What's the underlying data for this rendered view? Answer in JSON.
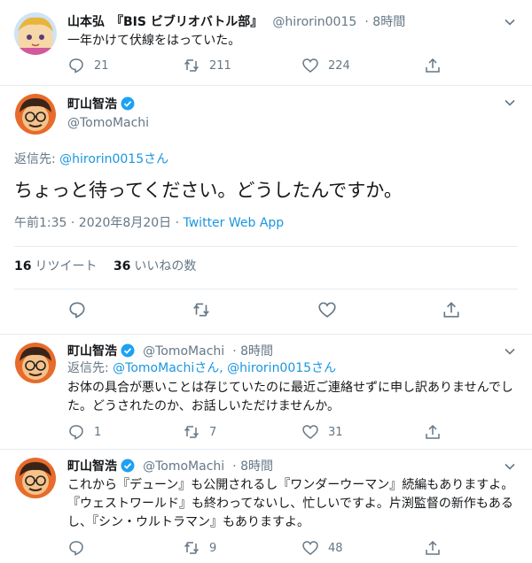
{
  "tweet1": {
    "name": "山本弘　『BIS ビブリオバトル部』",
    "handle": "@hirorin0015",
    "time": "· 8時間",
    "text": "一年かけて伏線をはっていた。",
    "replies": "21",
    "retweets": "211",
    "likes": "224"
  },
  "main": {
    "name": "町山智浩",
    "handle": "@TomoMachi",
    "reply_prefix": "返信先: ",
    "reply_target": "@hirorin0015",
    "reply_suffix": "さん",
    "text": "ちょっと待ってください。どうしたんですか。",
    "timestamp": "午前1:35 · 2020年8月20日 · ",
    "source": "Twitter Web App",
    "retweet_count": "16",
    "retweet_label": "リツイート",
    "like_count": "36",
    "like_label": "いいねの数"
  },
  "reply1": {
    "name": "町山智浩",
    "handle": "@TomoMachi",
    "time": "· 8時間",
    "reply_prefix": "返信先: ",
    "reply_target1": "@TomoMachi",
    "reply_mid": "さん, ",
    "reply_target2": "@hirorin0015",
    "reply_suffix": "さん",
    "text": "お体の具合が悪いことは存じていたのに最近ご連絡せずに申し訳ありませんでした。どうされたのか、お話しいただけませんか。",
    "replies": "1",
    "retweets": "7",
    "likes": "31"
  },
  "reply2": {
    "name": "町山智浩",
    "handle": "@TomoMachi",
    "time": "· 8時間",
    "text": "これから『デューン』も公開されるし『ワンダーウーマン』続編もありますよ。『ウェストワールド』も終わってないし、忙しいですよ。片渕監督の新作もあるし、『シン・ウルトラマン』もありますよ。",
    "replies": "",
    "retweets": "9",
    "likes": "48"
  },
  "colors": {
    "link": "#1b95e0",
    "grey": "#657786",
    "divider": "#e6ecf0",
    "verified": "#1da1f2"
  }
}
